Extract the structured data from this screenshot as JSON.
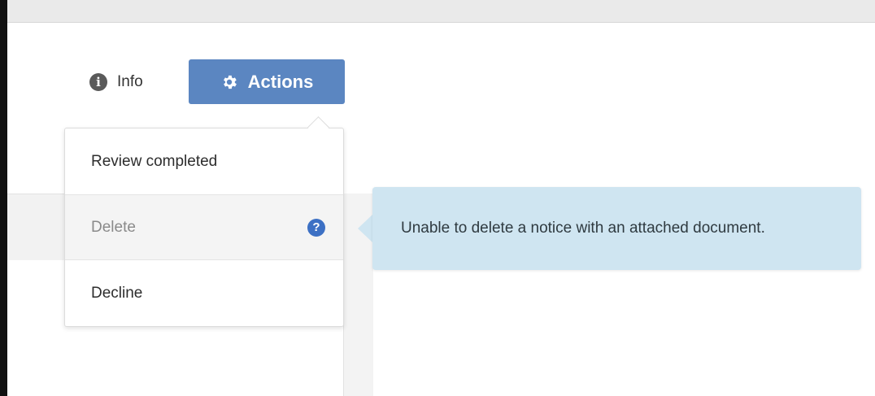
{
  "toolbar": {
    "info_label": "Info",
    "info_icon": "info-circle-icon",
    "actions_label": "Actions",
    "actions_icon": "gear-icon",
    "accent_color": "#5b86c1"
  },
  "actions_menu": {
    "items": [
      {
        "label": "Review completed",
        "disabled": false
      },
      {
        "label": "Delete",
        "disabled": true,
        "icon": "question-circle-icon"
      },
      {
        "label": "Decline",
        "disabled": false
      }
    ]
  },
  "tooltip": {
    "text": "Unable to delete a notice with an attached document.",
    "background_color": "#cfe5f1"
  },
  "help_icon_glyph": "?",
  "info_icon_glyph": "i"
}
